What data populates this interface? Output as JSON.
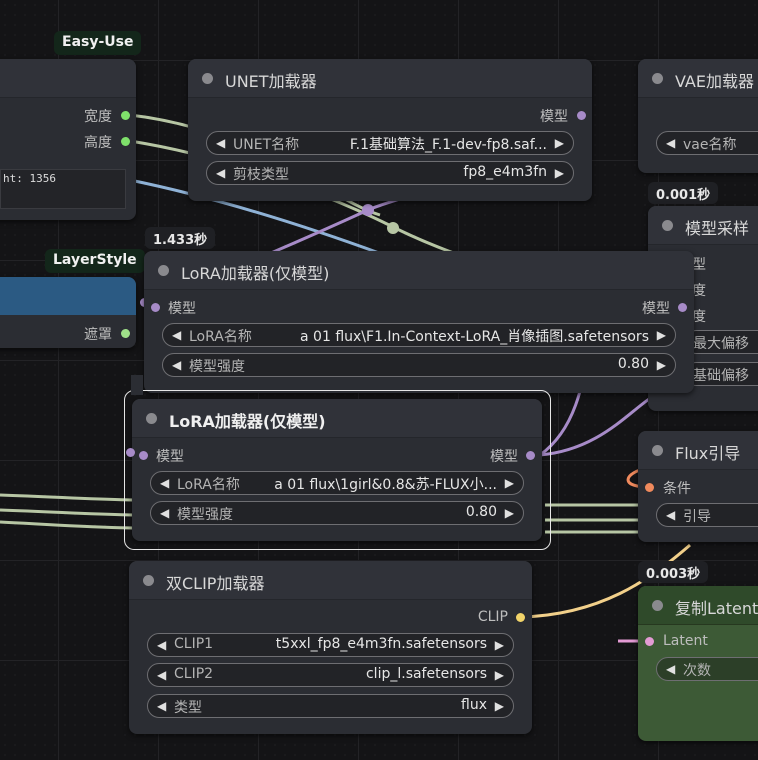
{
  "colors": {
    "canvas": "#141416",
    "node_body": "#2b2d33",
    "pin_image_size": "#7fe06b",
    "pin_model": "#a78bc8",
    "pin_mask": "#9fe089",
    "pin_clip": "#f2d46a",
    "pin_conditioning": "#f08a5d",
    "pin_latent": "#e39bd4",
    "latent_node": "#3d5a36",
    "layerstyle_bar": "#2b5a83",
    "selected_outline": "#e6e6e6"
  },
  "groups": {
    "easy_use": "Easy-Use",
    "layerstyle": "LayerStyle"
  },
  "badges": {
    "vae_time": "0.001秒",
    "lora1_time": "1.433秒",
    "latent_time": "0.003秒"
  },
  "easy_node": {
    "out_width": "宽度",
    "out_height": "高度",
    "info_text": "ht: 1356"
  },
  "layer_node": {
    "out_mask": "遮罩"
  },
  "unet": {
    "title": "UNET加载器",
    "out_model": "模型",
    "w_name_label": "UNET名称",
    "w_name_value": "F.1基础算法_F.1-dev-fp8.saf...",
    "w_dtype_label": "剪枝类型",
    "w_dtype_value": "fp8_e4m3fn"
  },
  "vae": {
    "title": "VAE加载器",
    "w_name_label": "vae名称"
  },
  "sampler": {
    "title": "模型采样",
    "r1": "型",
    "r2": "度",
    "r3": "度",
    "r4": "最大偏移",
    "r5": "基础偏移"
  },
  "lora1": {
    "title": "LoRA加载器(仅模型)",
    "in_model": "模型",
    "out_model": "模型",
    "w_name_label": "LoRA名称",
    "w_name_value": "a 01 flux\\F1.In-Context-LoRA_肖像插图.safetensors",
    "w_strength_label": "模型强度",
    "w_strength_value": "0.80"
  },
  "lora2": {
    "title": "LoRA加载器(仅模型)",
    "in_model": "模型",
    "out_model": "模型",
    "w_name_label": "LoRA名称",
    "w_name_value": "a 01 flux\\1girl&0.8&苏-FLUX小...",
    "w_strength_label": "模型强度",
    "w_strength_value": "0.80"
  },
  "flux": {
    "title": "Flux引导",
    "in_cond": "条件",
    "w_guidance_label": "引导"
  },
  "clip": {
    "title": "双CLIP加载器",
    "out_clip": "CLIP",
    "w_clip1_label": "CLIP1",
    "w_clip1_value": "t5xxl_fp8_e4m3fn.safetensors",
    "w_clip2_label": "CLIP2",
    "w_clip2_value": "clip_l.safetensors",
    "w_type_label": "类型",
    "w_type_value": "flux"
  },
  "latent": {
    "title": "复制Latent",
    "in_latent": "Latent",
    "w_count_label": "次数"
  },
  "arrows": {
    "left": "◀",
    "right": "▶"
  }
}
